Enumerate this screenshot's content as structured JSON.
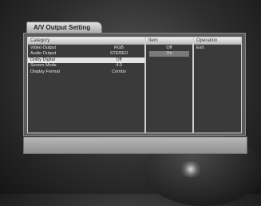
{
  "window": {
    "title": "A/V Output Setting"
  },
  "panes": {
    "category_header": "Category",
    "item_header": "Item",
    "operation_header": "Operation"
  },
  "categories": [
    {
      "label": "Video Output",
      "value": "RGB"
    },
    {
      "label": "Audio Output",
      "value": "STEREO"
    },
    {
      "label": "Dolby Digital",
      "value": "Off"
    },
    {
      "label": "Screen Mode",
      "value": "4:3"
    },
    {
      "label": "Display Format",
      "value": "Combo"
    }
  ],
  "selected_category_index": 2,
  "items": [
    "Off",
    "On"
  ],
  "highlighted_item_index": 1,
  "operations": [
    "Exit"
  ],
  "help_bar": {
    "text": ""
  },
  "colors": {
    "selected_row": "#e4e4e4",
    "pane_bg": "#3a3a3a",
    "frame_bg": "#5c5c5c"
  }
}
